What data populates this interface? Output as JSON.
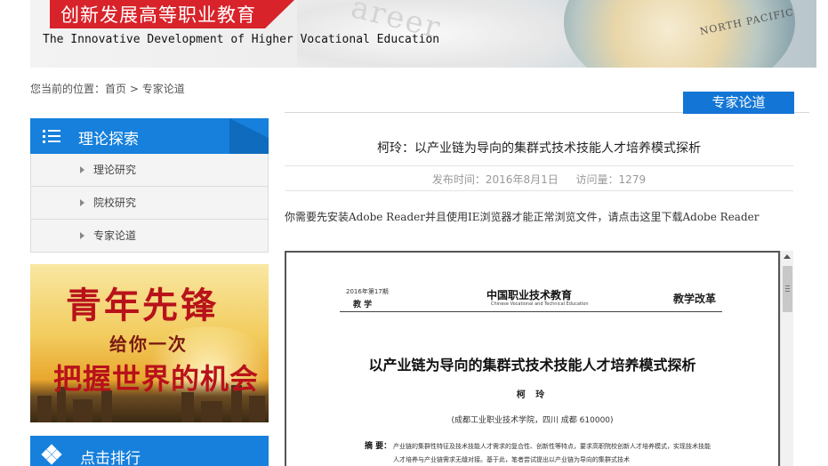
{
  "banner": {
    "cn_title": "创新发展高等职业教育",
    "en_title": "The Innovative Development of Higher Vocational Education",
    "paper_word": "areer",
    "globe_label": "NORTH PACIFIC"
  },
  "breadcrumb": {
    "prefix": "您当前的位置：",
    "home": "首页",
    "separator": " > ",
    "current": "专家论道"
  },
  "section_tag": "专家论道",
  "sidebar": {
    "title": "理论探索",
    "items": [
      {
        "label": "理论研究"
      },
      {
        "label": "院校研究"
      },
      {
        "label": "专家论道"
      }
    ],
    "promo": {
      "line1": "青年先锋",
      "line2": "给你一次",
      "line3": "把握世界的机会"
    },
    "ranking_title": "点击排行"
  },
  "article": {
    "title": "柯玲：以产业链为导向的集群式技术技能人才培养模式探析",
    "publish_label": "发布时间：2016年8月1日",
    "views_label": "访问量：1279",
    "notice": "你需要先安装Adobe Reader并且使用IE浏览器才能正常浏览文件，请点击这里下载Adobe Reader"
  },
  "pdf": {
    "issue": "2016年第17期",
    "section": "教 学",
    "journal": "中国职业技术教育",
    "journal_en": "Chinese Vocational and Technical Education",
    "column": "教学改革",
    "title": "以产业链为导向的集群式技术技能人才培养模式探析",
    "author": "柯 玲",
    "affiliation": "(成都工业职业技术学院，四川  成都  610000)",
    "abstract_label": "摘  要：",
    "abstract": "产业链的集群性特征及技术技能人才需求的复合性、创新性等特点，要求高职院校创新人才培养模式，实现技术技能人才培养与产业链需求无缝对接。基于此，笔者尝试提出以产业链为导向的集群式技术"
  },
  "colors": {
    "primary_blue": "#1680dc",
    "banner_red": "#d8232a"
  }
}
